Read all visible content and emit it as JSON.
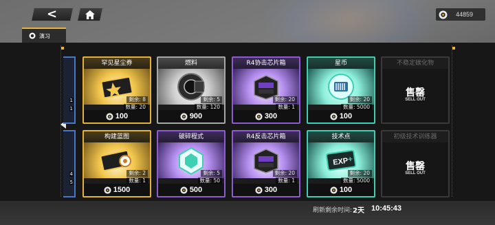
{
  "header": {
    "back_icon": "back-arrow-icon",
    "home_icon": "home-icon",
    "currency_icon": "shop-coin-icon",
    "currency_amount": "44859"
  },
  "tabs": [
    {
      "label": "演习",
      "icon": "target-icon",
      "active": true
    }
  ],
  "accent_color": "#e9b53a",
  "row1": [
    {
      "title": "罕见星尘券",
      "rarity": "gold",
      "remain": "剩余: 8",
      "qty": "数量: 20",
      "price": "100",
      "icon": "stardust-ticket-icon"
    },
    {
      "title": "燃料",
      "rarity": "silver",
      "remain": "剩余: 5",
      "qty": "数量: 120",
      "price": "900",
      "icon": "fuel-canister-icon"
    },
    {
      "title": "R4协击芯片箱",
      "rarity": "purple",
      "remain": "剩余: 20",
      "qty": "数量: 1",
      "price": "300",
      "icon": "chip-box-icon"
    },
    {
      "title": "星币",
      "rarity": "teal",
      "remain": "剩余: 20",
      "qty": "数量: 5000",
      "price": "100",
      "icon": "star-coin-icon"
    },
    {
      "title": "不稳定碳化物",
      "rarity": "soldout",
      "soldout_cn": "售罄",
      "soldout_en": "SELL OUT"
    }
  ],
  "row2": [
    {
      "title": "构建蓝图",
      "rarity": "gold",
      "remain": "剩余: 2",
      "qty": "数量: 1",
      "price": "1500",
      "icon": "blueprint-icon"
    },
    {
      "title": "破碎程式",
      "rarity": "purple",
      "remain": "剩余: 5",
      "qty": "数量: 50",
      "price": "500",
      "icon": "broken-program-icon"
    },
    {
      "title": "R4反击芯片箱",
      "rarity": "purple",
      "remain": "剩余: 20",
      "qty": "数量: 1",
      "price": "300",
      "icon": "chip-box-icon"
    },
    {
      "title": "技术点",
      "rarity": "teal",
      "remain": "剩余: 20",
      "qty": "数量: 5000",
      "price": "100",
      "icon": "exp-chip-icon"
    },
    {
      "title": "初级技术训练器",
      "rarity": "soldout",
      "soldout_cn": "售罄",
      "soldout_en": "SELL OUT"
    }
  ],
  "partial_left": {
    "row1": [
      "1",
      "1"
    ],
    "row2": [
      "4",
      "5"
    ]
  },
  "refresh": {
    "label": "刷新剩余时间:",
    "days": "2天",
    "time": "10:45:43"
  }
}
